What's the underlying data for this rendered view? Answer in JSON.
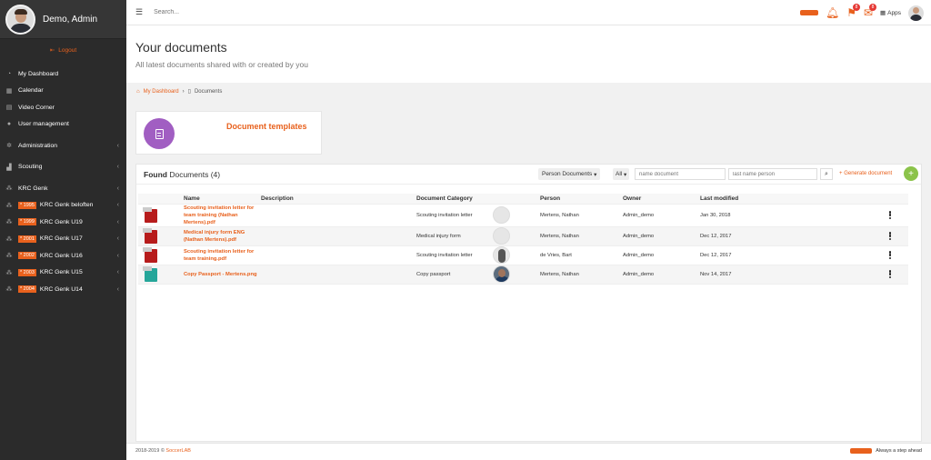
{
  "sidebar": {
    "user_name": "Demo, Admin",
    "logout": "Logout",
    "items": [
      {
        "label": "My Dashboard",
        "icon": "dashboard-icon"
      },
      {
        "label": "Calendar",
        "icon": "calendar-icon"
      },
      {
        "label": "Video Corner",
        "icon": "video-icon"
      },
      {
        "label": "User management",
        "icon": "user-icon"
      },
      {
        "label": "Administration",
        "icon": "gear-icon"
      },
      {
        "label": "Scouting",
        "icon": "scouting-icon"
      },
      {
        "label": "KRC Genk",
        "icon": "team-icon"
      },
      {
        "label": "KRC Genk beloften",
        "badge": "* 1995",
        "icon": "team-icon"
      },
      {
        "label": "KRC Genk U19",
        "badge": "* 1999",
        "icon": "team-icon"
      },
      {
        "label": "KRC Genk U17",
        "badge": "* 2001",
        "icon": "team-icon"
      },
      {
        "label": "KRC Genk U16",
        "badge": "* 2002",
        "icon": "team-icon"
      },
      {
        "label": "KRC Genk U15",
        "badge": "* 2003",
        "icon": "team-icon"
      },
      {
        "label": "KRC Genk U14",
        "badge": "* 2004",
        "icon": "team-icon"
      }
    ]
  },
  "topbar": {
    "search_placeholder": "Search...",
    "apps_label": "Apps",
    "badge1": "8",
    "badge2": "8"
  },
  "page": {
    "title": "Your documents",
    "subtitle": "All latest documents shared with or created by you"
  },
  "breadcrumb": {
    "home": "My Dashboard",
    "current": "Documents"
  },
  "templates": {
    "title": "Document templates"
  },
  "panel": {
    "found_bold": "Found",
    "found_rest": "Documents (4)",
    "filter_type": "Person Documents",
    "filter_all": "All",
    "name_placeholder": "name document",
    "person_placeholder": "last name person",
    "generate": "Generate document"
  },
  "table": {
    "headers": [
      "Name",
      "Description",
      "Document Category",
      "Person",
      "Owner",
      "Last modified"
    ],
    "rows": [
      {
        "name": "Scouting invitation letter for team training (Nathan Mertens).pdf",
        "description": "",
        "category": "Scouting invitation letter",
        "person": "Mertens, Nathan",
        "owner": "Admin_demo",
        "modified": "Jan 30, 2018"
      },
      {
        "name": "Medical injury form ENG (Nathan Mertens).pdf",
        "description": "",
        "category": "Medical injury form",
        "person": "Mertens, Nathan",
        "owner": "Admin_demo",
        "modified": "Dec 12, 2017"
      },
      {
        "name": "Scouting invitation letter for team training.pdf",
        "description": "",
        "category": "Scouting invitation letter",
        "person": "de Vries, Bart",
        "owner": "Admin_demo",
        "modified": "Dec 12, 2017"
      },
      {
        "name": "Copy Passport - Mertens.png",
        "description": "",
        "category": "Copy passport",
        "person": "Mertens, Nathan",
        "owner": "Admin_demo",
        "modified": "Nov 14, 2017"
      }
    ]
  },
  "footer": {
    "copyright": "2018-2019 ©",
    "brand": "SoccerLAB",
    "tagline": "Always a step ahead"
  },
  "colors": {
    "accent": "#e8611d",
    "sidebar": "#2b2b2b",
    "template_icon": "#a15ec2",
    "add_button": "#8bc34a"
  }
}
